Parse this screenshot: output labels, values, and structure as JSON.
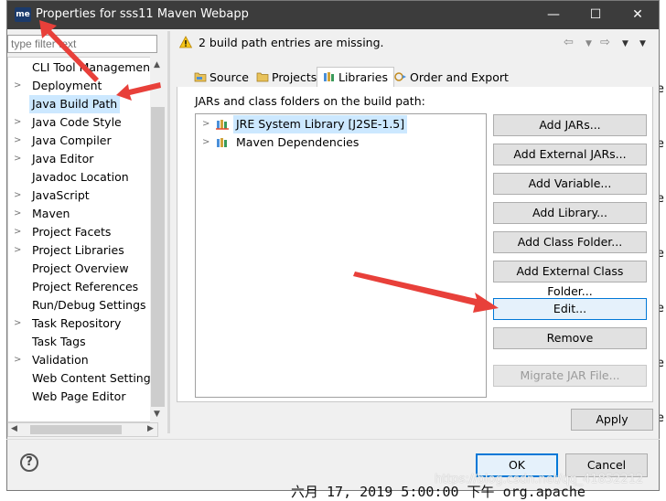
{
  "window": {
    "title": "Properties for sss11 Maven Webapp",
    "app_icon": "me",
    "controls": [
      "—",
      "☐",
      "✕"
    ]
  },
  "filter": {
    "placeholder": "type filter text"
  },
  "tree": {
    "items": [
      {
        "label": "CLI Tool Managemen",
        "expandable": false,
        "selected": false
      },
      {
        "label": "Deployment",
        "expandable": true,
        "selected": false
      },
      {
        "label": "Java Build Path",
        "expandable": false,
        "selected": true
      },
      {
        "label": "Java Code Style",
        "expandable": true,
        "selected": false
      },
      {
        "label": "Java Compiler",
        "expandable": true,
        "selected": false
      },
      {
        "label": "Java Editor",
        "expandable": true,
        "selected": false
      },
      {
        "label": "Javadoc Location",
        "expandable": false,
        "selected": false
      },
      {
        "label": "JavaScript",
        "expandable": true,
        "selected": false
      },
      {
        "label": "Maven",
        "expandable": true,
        "selected": false
      },
      {
        "label": "Project Facets",
        "expandable": true,
        "selected": false
      },
      {
        "label": "Project Libraries",
        "expandable": true,
        "selected": false
      },
      {
        "label": "Project Overview",
        "expandable": false,
        "selected": false
      },
      {
        "label": "Project References",
        "expandable": false,
        "selected": false
      },
      {
        "label": "Run/Debug Settings",
        "expandable": false,
        "selected": false
      },
      {
        "label": "Task Repository",
        "expandable": true,
        "selected": false
      },
      {
        "label": "Task Tags",
        "expandable": false,
        "selected": false
      },
      {
        "label": "Validation",
        "expandable": true,
        "selected": false
      },
      {
        "label": "Web Content Settings",
        "expandable": false,
        "selected": false
      },
      {
        "label": "Web Page Editor",
        "expandable": false,
        "selected": false
      }
    ]
  },
  "warning": {
    "text": "2 build path entries are missing."
  },
  "tabs": [
    {
      "label": "Source",
      "icon": "source-folder-icon"
    },
    {
      "label": "Projects",
      "icon": "projects-folder-icon"
    },
    {
      "label": "Libraries",
      "icon": "libraries-icon",
      "active": true
    },
    {
      "label": "Order and Export",
      "icon": "order-export-icon"
    }
  ],
  "libraries": {
    "caption": "JARs and class folders on the build path:",
    "entries": [
      {
        "label": "JRE System Library [J2SE-1.5]",
        "selected": true
      },
      {
        "label": "Maven Dependencies",
        "selected": false
      }
    ]
  },
  "buttons": {
    "add_jars": "Add JARs...",
    "add_external_jars": "Add External JARs...",
    "add_variable": "Add Variable...",
    "add_library": "Add Library...",
    "add_class_folder": "Add Class Folder...",
    "add_external_class_folder": "Add External Class Folder...",
    "edit": "Edit...",
    "remove": "Remove",
    "migrate_jar": "Migrate JAR File...",
    "apply": "Apply",
    "ok": "OK",
    "cancel": "Cancel"
  },
  "background": {
    "bottom_line": "六月 17, 2019 5:00:00 下午 org.apache",
    "watermark": "https://blog.csdn.net/qq_41852212"
  },
  "colors": {
    "titlebar": "#3c3c3c",
    "selection": "#cce8ff",
    "focus_border": "#0078d7",
    "annotation_arrow": "#e8403a"
  }
}
